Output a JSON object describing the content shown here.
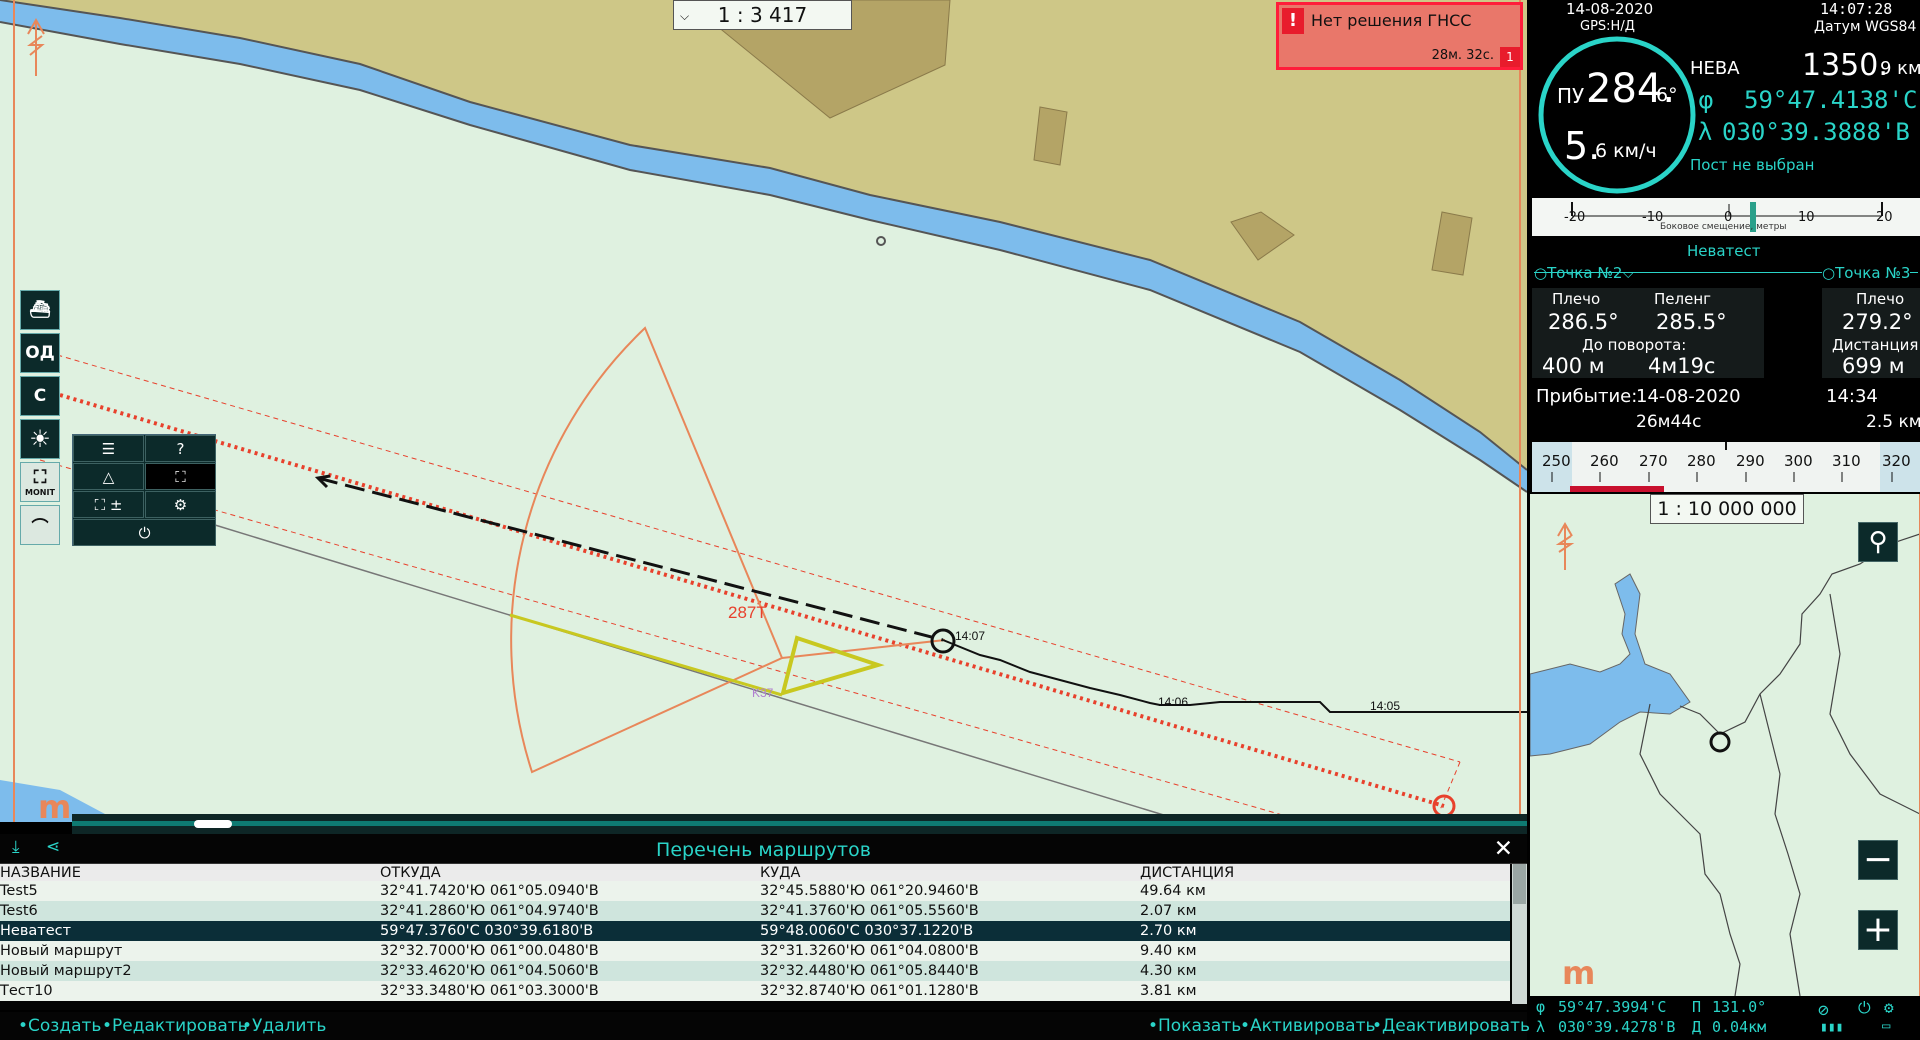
{
  "map": {
    "scale": "1 : 3 417",
    "bearing_label": "287T",
    "time_labels": [
      "14:07",
      "14:06",
      "14:05"
    ],
    "kp_label": "K37",
    "logo": "m"
  },
  "alarm": {
    "text": "Нет решения ГНСС",
    "time": "28м. 32с.",
    "count": "1",
    "icon": "!"
  },
  "left_toolbar": [
    {
      "name": "ship-icon",
      "label": ""
    },
    {
      "name": "od-button",
      "label": "ОД"
    },
    {
      "name": "c-button",
      "label": "С"
    },
    {
      "name": "brightness-icon",
      "label": ""
    },
    {
      "name": "monit-icon",
      "label": "MONIT"
    },
    {
      "name": "track-icon",
      "label": ""
    }
  ],
  "status": {
    "date": "14-08-2020",
    "time": "14:07:28",
    "gps": "GPS:Н/Д",
    "datum": "Датум WGS84"
  },
  "nav": {
    "course_prefix": "ПУ",
    "course": "284.",
    "course_dec": "6°",
    "speed": "5.",
    "speed_dec": "6 км/ч",
    "river": "НЕВА",
    "distance": "1350.",
    "distance_dec": "9 км",
    "lat_sym": "φ",
    "lat": "59°47.4138'С",
    "lon_sym": "λ",
    "lon": "030°39.3888'В",
    "post": "Пост не выбран"
  },
  "xte": {
    "ticks": [
      "-20",
      "-10",
      "0",
      "10",
      "20"
    ],
    "caption": "Боковое смещение, метры"
  },
  "route": {
    "name": "Неватест",
    "point_from": "Точка №2",
    "point_to": "Точка №3",
    "shoulder_label": "Плечо",
    "shoulder": "286.5°",
    "bearing_label": "Пеленг",
    "bearing": "285.5°",
    "to_turn_label": "До поворота:",
    "to_turn_dist": "400 м",
    "to_turn_time": "4м19с",
    "next_shoulder_label": "Плечо",
    "next_shoulder": "279.2°",
    "dist_label": "Дистанция",
    "dist": "699 м",
    "arrival_label": "Прибытие:",
    "arrival_date": "14-08-2020",
    "arrival_time": "14:34",
    "remain_time": "26м44с",
    "remain_dist": "2.5 км"
  },
  "compass": {
    "ticks": [
      "250",
      "260",
      "270",
      "280",
      "290",
      "300",
      "310",
      "320"
    ]
  },
  "minimap": {
    "scale": "1 : 10 000 000",
    "zoom_out": "−",
    "zoom_in": "+",
    "logo": "m"
  },
  "footer": {
    "lat_sym": "φ",
    "lat": "59°47.3994'С",
    "lon_sym": "λ",
    "lon": "030°39.4278'В",
    "bearing_sym": "П",
    "bearing": "131.0°",
    "dist_sym": "Д",
    "dist": "0.04км"
  },
  "routes_panel": {
    "title": "Перечень маршрутов",
    "columns": [
      "НАЗВАНИЕ",
      "ОТКУДА",
      "КУДА",
      "ДИСТАНЦИЯ"
    ],
    "rows": [
      {
        "name": "Test5",
        "from": "32°41.7420'Ю 061°05.0940'В",
        "to": "32°45.5880'Ю 061°20.9460'В",
        "dist": "49.64 км"
      },
      {
        "name": "Test6",
        "from": "32°41.2860'Ю 061°04.9740'В",
        "to": "32°41.3760'Ю 061°05.5560'В",
        "dist": "2.07 км"
      },
      {
        "name": "Неватест",
        "from": "59°47.3760'С 030°39.6180'В",
        "to": "59°48.0060'С 030°37.1220'В",
        "dist": "2.70 км"
      },
      {
        "name": "Новый маршрут",
        "from": "32°32.7000'Ю 061°00.0480'В",
        "to": "32°31.3260'Ю 061°04.0800'В",
        "dist": "9.40 км"
      },
      {
        "name": "Новый маршрут2",
        "from": "32°33.4620'Ю 061°04.5060'В",
        "to": "32°32.4480'Ю 061°05.8440'В",
        "dist": "4.30 км"
      },
      {
        "name": "Тест10",
        "from": "32°33.3480'Ю 061°03.3000'В",
        "to": "32°32.8740'Ю 061°01.1280'В",
        "dist": "3.81 км"
      }
    ],
    "selected": 2
  },
  "actions": {
    "create": "•Создать",
    "edit": "•Редактировать",
    "delete": "•Удалить",
    "show": "•Показать",
    "activate": "•Активировать",
    "deactivate": "•Деактивировать"
  },
  "colors": {
    "land": "#cec787",
    "water": "#7dbcec",
    "shallow": "#dff1e0",
    "accent": "#2ad4c8",
    "alarm": "#e9776a",
    "route": "#e8412c"
  }
}
